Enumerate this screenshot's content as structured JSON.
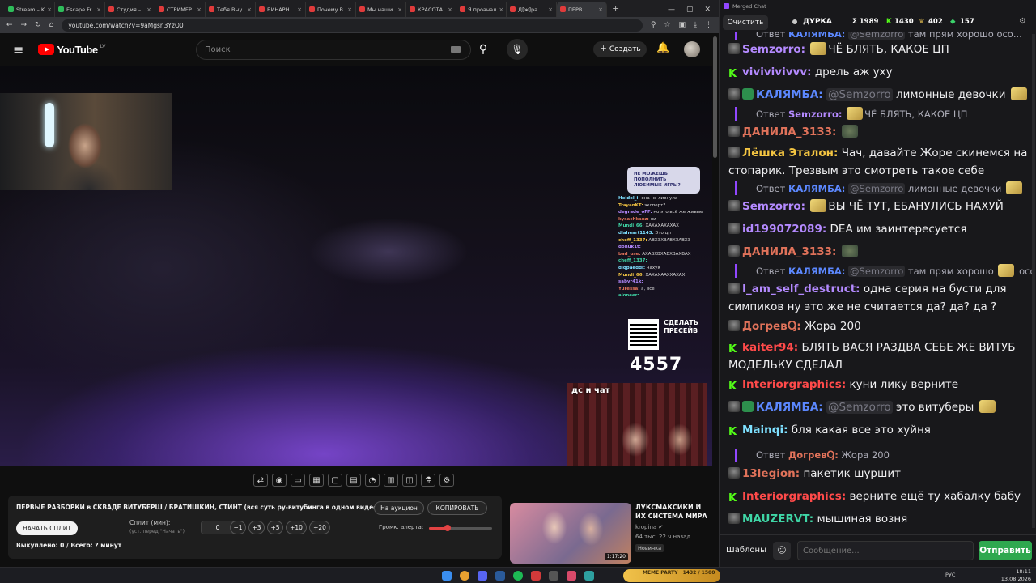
{
  "browser": {
    "tabs": [
      {
        "label": "Stream – K",
        "fav": "kick-icon"
      },
      {
        "label": "Escape Fr",
        "fav": "kick-icon"
      },
      {
        "label": "Студия –",
        "fav": "youtube-icon"
      },
      {
        "label": "СТРИМЕР",
        "fav": "youtube-icon"
      },
      {
        "label": "Тебя Выу",
        "fav": "youtube-icon"
      },
      {
        "label": "БИНАРН",
        "fav": "youtube-icon"
      },
      {
        "label": "Почему В",
        "fav": "youtube-icon"
      },
      {
        "label": "Мы наши",
        "fav": "youtube-icon"
      },
      {
        "label": "КРАСОТА",
        "fav": "youtube-icon"
      },
      {
        "label": "Я проанал",
        "fav": "youtube-icon"
      },
      {
        "label": "Д[ж]ра",
        "fav": "youtube-icon"
      },
      {
        "label": "ПЕРВ",
        "fav": "youtube-icon",
        "active": true
      }
    ],
    "new_tab": "+",
    "url": "youtube.com/watch?v=9aMgsn3YzQ0"
  },
  "youtube": {
    "logo_word": "YouTube",
    "country": "LV",
    "search_placeholder": "Поиск",
    "create_label": "Создать"
  },
  "overlay": {
    "sub_badge": "НЕ МОЖЕШЬ ПОПОЛНИТЬ ЛЮБИМЫЕ ИГРЫ?",
    "mini_chat": [
      {
        "user": "Heidel_i:",
        "text": "она не ливнула"
      },
      {
        "user": "TrayanKT:",
        "text": "эксперт?"
      },
      {
        "user": "degrade_oFF:",
        "text": "но это всё же живые"
      },
      {
        "user": "kysachkaxz:",
        "text": "ни"
      },
      {
        "user": "Mundi_66:",
        "text": "ХАХАХАХАХАХ"
      },
      {
        "user": "dlaheart1143:",
        "text": "Это цп"
      },
      {
        "user": "cheff_1337:",
        "text": "АВХЗХЗАВХЗАВХЗ"
      },
      {
        "user": "donuk1t:",
        "text": ""
      },
      {
        "user": "bad_use:",
        "text": "АХАВХВХАВХВАХВАХ"
      },
      {
        "user": "cheff_1337:",
        "text": ""
      },
      {
        "user": "diqpaeddi:",
        "text": "нахуя"
      },
      {
        "user": "Mundi_66:",
        "text": "ХАХАХААХХАХАХ"
      },
      {
        "user": "sabyr41k:",
        "text": ""
      },
      {
        "user": "Yuressa:",
        "text": "а, все"
      },
      {
        "user": "aloneer:",
        "text": ""
      }
    ],
    "qr_text": "СДЕЛАТЬ ПРЕСЕЙВ",
    "counter": "4557",
    "ds_label": "дс и чат"
  },
  "panel": {
    "title": "ПЕРВЫЕ РАЗБОРКИ в СКВАДЕ ВИТУБЕРШ / БРАТИШКИН, СТИНТ (вся суть ру-витубинга в одном видео)",
    "auction_btn": "На аукцион",
    "copy_btn": "КОПИРОВАТЬ",
    "split_btn": "НАЧАТЬ СПЛИТ",
    "split_label": "Сплит (мин):",
    "split_sub": "(уст. перед \"Начать\")",
    "split_value": "0",
    "steps": [
      "+1",
      "+3",
      "+5",
      "+10",
      "+20"
    ],
    "volume_label": "Громк. алерта:",
    "volume_fraction": 0.3,
    "bought": "Выкуплено: 0 / Всего: ? минут"
  },
  "recommendation": {
    "title": "ЛУКСМАКСИКИ И ИХ СИСТЕМА МИРА",
    "channel": "kropina",
    "meta": "64 тыс.  22 ч назад",
    "badge": "Новинка",
    "duration": "1:17:20"
  },
  "chat": {
    "window_title": "Merged Chat",
    "clear_btn": "Очистить",
    "stream_name": "ДУРКА",
    "stats": [
      {
        "icon": "sigma-icon",
        "value": "Σ 1989"
      },
      {
        "icon": "kick-icon",
        "value": "1430"
      },
      {
        "icon": "crown-icon",
        "value": "402"
      },
      {
        "icon": "gem-icon",
        "value": "157"
      }
    ],
    "messages": [
      {
        "kind": "reply",
        "prefix": "Ответ",
        "user": "КАЛЯМБА:",
        "mention": "@Semzorro",
        "text": "там прям хорошо",
        "tail": "осо...",
        "color": "#5c88ff"
      },
      {
        "kind": "msg",
        "badge": "mod",
        "user": "Semzorro:",
        "color": "#b48aff",
        "emote": true,
        "text": "ЧЁ БЛЯТЬ, КАКОЕ ЦП"
      },
      {
        "kind": "msg",
        "badge": "k",
        "user": "vivivivivvv:",
        "color": "#b48aff",
        "text": "дрель аж уху"
      },
      {
        "kind": "msg",
        "badge": "mod-shield",
        "user": "КАЛЯМБА:",
        "color": "#5c88ff",
        "mention": "@Semzorro",
        "text": "лимонные девочки",
        "emote_after": true
      },
      {
        "kind": "reply",
        "prefix": "Ответ",
        "user": "Semzorro:",
        "color": "#b48aff",
        "emote": true,
        "text": "ЧЁ БЛЯТЬ, КАКОЕ ЦП"
      },
      {
        "kind": "msg",
        "badge": "mod",
        "user": "ДАНИЛА_3133:",
        "color": "#e0725a",
        "emote_dark": true,
        "text": ""
      },
      {
        "kind": "msg",
        "badge": "mod",
        "user": "Лёшка Эталон:",
        "color": "#f4c542",
        "text": "Чач, давайте Жоре скинемся на стопарик. Трезвым это смотреть такое себе"
      },
      {
        "kind": "reply",
        "prefix": "Ответ",
        "user": "КАЛЯМБА:",
        "color": "#5c88ff",
        "mention": "@Semzorro",
        "text": "лимонные девочки",
        "emote_after": true
      },
      {
        "kind": "msg",
        "badge": "mod",
        "user": "Semzorro:",
        "color": "#b48aff",
        "emote": true,
        "text": "ВЫ ЧЁ ТУТ, ЕБАНУЛИСЬ НАХУЙ"
      },
      {
        "kind": "msg",
        "badge": "mod",
        "user": "id199072089:",
        "color": "#b48aff",
        "text": "DEA им заинтересуется"
      },
      {
        "kind": "msg",
        "badge": "mod",
        "user": "ДАНИЛА_3133:",
        "color": "#e0725a",
        "emote_dark": true,
        "text": ""
      },
      {
        "kind": "reply",
        "prefix": "Ответ",
        "user": "КАЛЯМБА:",
        "color": "#5c88ff",
        "mention": "@Semzorro",
        "text": "там прям хорошо",
        "tail": "осо...",
        "emote_mid": true
      },
      {
        "kind": "msg",
        "badge": "mod",
        "user": "I_am_self_destruct:",
        "color": "#b48aff",
        "text": "одна серия на бусти для симпиков ну это же не считается да? да? да ?"
      },
      {
        "kind": "msg",
        "badge": "mod",
        "user": "ДогревႳ:",
        "color": "#e0725a",
        "text": "Жора 200"
      },
      {
        "kind": "msg",
        "badge": "k",
        "user": "kaiter94:",
        "color": "#ff4a4a",
        "text": "БЛЯТЬ ВАСЯ РАЗДВА СЕБЕ ЖЕ ВИТУБ МОДЕЛЬКУ СДЕЛАЛ"
      },
      {
        "kind": "msg",
        "badge": "k",
        "user": "Interiorgraphics:",
        "color": "#ff4a4a",
        "text": "куни лику верните"
      },
      {
        "kind": "msg",
        "badge": "mod-shield",
        "user": "КАЛЯМБА:",
        "color": "#5c88ff",
        "mention": "@Semzorro",
        "text": "это витуберы",
        "emote_after": true
      },
      {
        "kind": "msg",
        "badge": "k",
        "user": "Mainqi:",
        "color": "#7ee0ff",
        "text": "бля какая все это хуйня"
      },
      {
        "kind": "reply",
        "prefix": "Ответ",
        "user": "ДогревႳ:",
        "color": "#e0725a",
        "text": "Жора 200"
      },
      {
        "kind": "msg",
        "badge": "mod",
        "user": "13legion:",
        "color": "#e0725a",
        "text": "пакетик  шуршит"
      },
      {
        "kind": "msg",
        "badge": "k",
        "user": "Interiorgraphics:",
        "color": "#ff4a4a",
        "text": "верните ещё ту хабалку бабу"
      },
      {
        "kind": "msg",
        "badge": "mod",
        "user": "MAUZERVT:",
        "color": "#3fd6a6",
        "text": "мышиная возня"
      }
    ],
    "templates_btn": "Шаблоны",
    "input_placeholder": "Сообщение...",
    "send_btn": "Отправить"
  },
  "taskbar": {
    "meme_badge": "MEME PARTY",
    "meme_progress": "1432 / 1500",
    "lang": "РУС",
    "time": "18:11",
    "date": "13.08.2026"
  }
}
